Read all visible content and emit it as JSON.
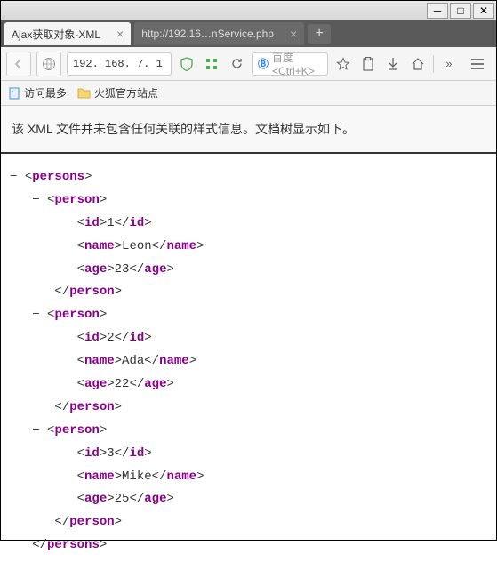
{
  "window": {
    "minimize": "─",
    "maximize": "□",
    "close": "✕"
  },
  "tabs": {
    "active": {
      "title": "Ajax获取对象-XML"
    },
    "inactive": {
      "title": "http://192.16…nService.php"
    },
    "newtab": "+"
  },
  "toolbar": {
    "url": "192. 168. 7. 1",
    "search_placeholder": "百度 <Ctrl+K>",
    "search_engine_icon": "Ⓑ",
    "overflow": "»"
  },
  "bookmarks": {
    "most_visited": "访问最多",
    "firefox_site": "火狐官方站点"
  },
  "message": "该 XML 文件并未包含任何关联的样式信息。文档树显示如下。",
  "xml": {
    "root": "persons",
    "item_tag": "person",
    "fields": {
      "id": "id",
      "name": "name",
      "age": "age"
    },
    "data": [
      {
        "id": "1",
        "name": "Leon",
        "age": "23"
      },
      {
        "id": "2",
        "name": "Ada",
        "age": "22"
      },
      {
        "id": "3",
        "name": "Mike",
        "age": "25"
      }
    ]
  }
}
